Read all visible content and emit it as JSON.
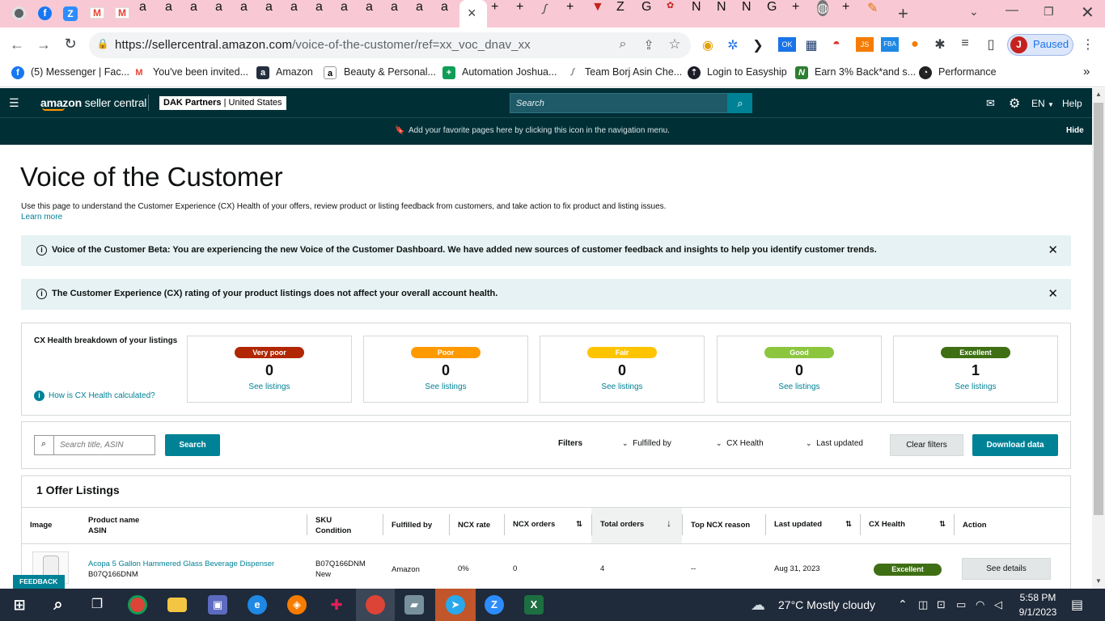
{
  "browser": {
    "tab_close_glyph": "×",
    "new_tab_glyph": "+",
    "url_host": "https://sellercentral.amazon.com",
    "url_path": "/voice-of-the-customer/ref=xx_voc_dnav_xx",
    "profile_initial": "J",
    "profile_status": "Paused",
    "bookmarks": [
      {
        "label": "(5) Messenger | Fac...",
        "icon": "facebook-icon"
      },
      {
        "label": "You've been invited...",
        "icon": "gmail-icon"
      },
      {
        "label": "Amazon",
        "icon": "amazon-icon"
      },
      {
        "label": "Beauty & Personal...",
        "icon": "amazon-icon"
      },
      {
        "label": "Automation Joshua...",
        "icon": "sheets-icon"
      },
      {
        "label": "Team Borj Asin Che...",
        "icon": "sheet-icon"
      },
      {
        "label": "Login to Easyship",
        "icon": "easyship-icon"
      },
      {
        "label": "Earn 3% Back*and s...",
        "icon": "rakuten-icon"
      },
      {
        "label": "Performance",
        "icon": "performance-icon"
      }
    ],
    "more_bookmarks_glyph": "»"
  },
  "header": {
    "logo_brand": "amazon",
    "logo_product": "seller central",
    "store_name": "DAK Partners",
    "store_region": "United States",
    "search_placeholder": "Search",
    "language": "EN",
    "help": "Help",
    "nav_hint": "Add your favorite pages here by clicking this icon in the navigation menu.",
    "hide": "Hide"
  },
  "page": {
    "title": "Voice of the Customer",
    "intro": "Use this page to understand the Customer Experience (CX) Health of your offers, review product or listing feedback from customers, and take action to fix product and listing issues.",
    "learn_more": "Learn more",
    "alerts": [
      {
        "text": "Voice of the Customer Beta: You are experiencing the new Voice of the Customer Dashboard. We have added new sources of customer feedback and insights to help you identify customer trends."
      },
      {
        "text": "The Customer Experience (CX) rating of your product listings does not affect your overall account health."
      }
    ]
  },
  "health": {
    "title": "CX Health breakdown of your listings",
    "how_link": "How is CX Health calculated?",
    "cards": [
      {
        "label": "Very poor",
        "count": "0",
        "link": "See listings",
        "color": "#b12704",
        "text_color": "#ffffff"
      },
      {
        "label": "Poor",
        "count": "0",
        "link": "See listings",
        "color": "#ff9900",
        "text_color": "#ffffff"
      },
      {
        "label": "Fair",
        "count": "0",
        "link": "See listings",
        "color": "#ffc400",
        "text_color": "#ffffff"
      },
      {
        "label": "Good",
        "count": "0",
        "link": "See listings",
        "color": "#8cc63f",
        "text_color": "#ffffff"
      },
      {
        "label": "Excellent",
        "count": "1",
        "link": "See listings",
        "color": "#3f6f14",
        "text_color": "#ffffff"
      }
    ]
  },
  "filters": {
    "search_placeholder": "Search title, ASIN",
    "search_button": "Search",
    "label": "Filters",
    "fulfilled_by": "Fulfilled by",
    "cx_health": "CX Health",
    "last_updated": "Last updated",
    "clear": "Clear filters",
    "download": "Download data"
  },
  "table": {
    "title": "1 Offer Listings",
    "columns": {
      "image": "Image",
      "product_name": "Product name",
      "asin": "ASIN",
      "sku": "SKU",
      "condition": "Condition",
      "fulfilled_by": "Fulfilled by",
      "ncx_rate": "NCX rate",
      "ncx_orders": "NCX orders",
      "total_orders": "Total orders",
      "top_reason": "Top NCX reason",
      "last_updated": "Last updated",
      "cx_health": "CX Health",
      "action": "Action"
    },
    "rows": [
      {
        "product_name": "Acopa 5 Gallon Hammered Glass Beverage Dispenser",
        "asin": "B07Q166DNM",
        "sku": "B07Q166DNM",
        "condition": "New",
        "fulfilled_by": "Amazon",
        "ncx_rate": "0%",
        "ncx_orders": "0",
        "total_orders": "4",
        "top_reason": "--",
        "last_updated": "Aug 31, 2023",
        "cx_health": "Excellent",
        "action": "See details"
      }
    ]
  },
  "feedback": "FEEDBACK ✕",
  "taskbar": {
    "weather": "27°C  Mostly cloudy",
    "time": "5:58 PM",
    "date": "9/1/2023"
  }
}
